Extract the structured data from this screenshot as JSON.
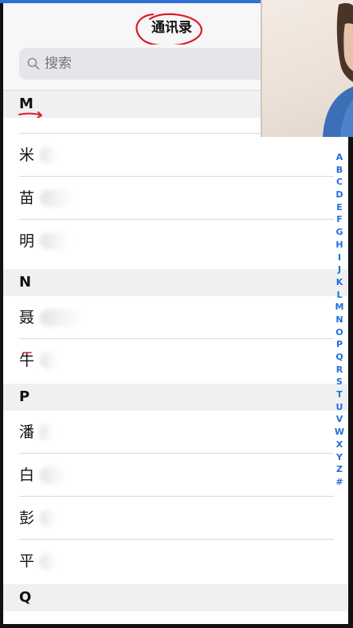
{
  "nav": {
    "title": "通讯录"
  },
  "search": {
    "placeholder": "搜索"
  },
  "sections": [
    {
      "letter": "M",
      "contacts": [
        "米",
        "苗",
        "明"
      ]
    },
    {
      "letter": "N",
      "contacts": [
        "聂",
        "牛"
      ]
    },
    {
      "letter": "P",
      "contacts": [
        "潘",
        "白",
        "彭",
        "平"
      ]
    },
    {
      "letter": "Q",
      "contacts": []
    }
  ],
  "index": [
    "A",
    "B",
    "C",
    "D",
    "E",
    "F",
    "G",
    "H",
    "I",
    "J",
    "K",
    "L",
    "M",
    "N",
    "O",
    "P",
    "Q",
    "R",
    "S",
    "T",
    "U",
    "V",
    "W",
    "X",
    "Y",
    "Z",
    "#"
  ],
  "colors": {
    "accent": "#1f6fd9",
    "annotation": "#e0182b",
    "header_bg": "#f0f0f2"
  },
  "icons": {
    "search": "magnifier-icon"
  }
}
